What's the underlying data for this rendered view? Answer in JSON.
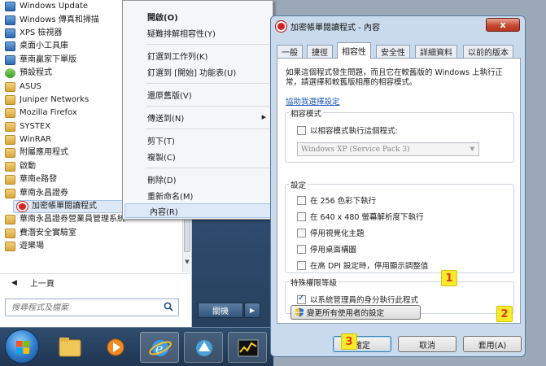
{
  "start_menu": {
    "programs": [
      {
        "label": "Windows Update",
        "icon": "app"
      },
      {
        "label": "Windows 傳真和掃描",
        "icon": "app"
      },
      {
        "label": "XPS 檢視器",
        "icon": "app"
      },
      {
        "label": "桌面小工具庫",
        "icon": "app"
      },
      {
        "label": "華南贏家下單版",
        "icon": "app"
      },
      {
        "label": "預設程式",
        "icon": "green"
      },
      {
        "label": "ASUS",
        "icon": "folder"
      },
      {
        "label": "Juniper Networks",
        "icon": "folder"
      },
      {
        "label": "Mozilla Firefox",
        "icon": "folder"
      },
      {
        "label": "SYSTEX",
        "icon": "folder"
      },
      {
        "label": "WinRAR",
        "icon": "folder"
      },
      {
        "label": "附屬應用程式",
        "icon": "folder"
      },
      {
        "label": "啟動",
        "icon": "folder"
      },
      {
        "label": "華南e路發",
        "icon": "folder"
      },
      {
        "label": "華南永昌證券",
        "icon": "folder"
      },
      {
        "label": "加密帳單閱讀程式",
        "icon": "red",
        "sub": true,
        "highlighted": true
      },
      {
        "label": "華南永昌證券營業員管理系統",
        "icon": "folder"
      },
      {
        "label": "費潛安全實驗室",
        "icon": "folder"
      },
      {
        "label": "遊樂場",
        "icon": "folder"
      }
    ],
    "back_label": "上一頁",
    "search_placeholder": "搜尋程式及檔案",
    "shutdown_label": "關機"
  },
  "context_menu": {
    "items": [
      {
        "label": "開啟(O)",
        "bold": true
      },
      {
        "label": "疑難排解相容性(Y)"
      },
      {
        "label": "釘選到工作列(K)"
      },
      {
        "label": "釘選到 [開始] 功能表(U)"
      },
      {
        "label": "還原舊版(V)"
      },
      {
        "label": "傳送到(N)",
        "submenu": true
      },
      {
        "label": "剪下(T)"
      },
      {
        "label": "複製(C)"
      },
      {
        "label": "刪除(D)"
      },
      {
        "label": "重新命名(M)"
      },
      {
        "label": "內容(R)",
        "selected": true
      }
    ]
  },
  "dialog": {
    "title": "加密帳單閱讀程式 - 內容",
    "close_label": "x",
    "tabs": [
      {
        "label": "一般"
      },
      {
        "label": "捷徑"
      },
      {
        "label": "相容性",
        "active": true
      },
      {
        "label": "安全性"
      },
      {
        "label": "詳細資料"
      },
      {
        "label": "以前的版本"
      }
    ],
    "description": "如果這個程式發生問題，而且它在較舊版的 Windows 上執行正常，請選擇和較舊版相應的相容模式。",
    "help_link": "協助我選擇設定",
    "compat_mode": {
      "group_label": "相容模式",
      "checkbox_label": "以相容模式執行這個程式:",
      "checked": false,
      "combo_value": "Windows XP (Service Pack 3)"
    },
    "settings": {
      "group_label": "設定",
      "options": [
        {
          "label": "在 256 色彩下執行",
          "checked": false
        },
        {
          "label": "在 640 x 480 螢幕解析度下執行",
          "checked": false
        },
        {
          "label": "停用視覺化主題",
          "checked": false
        },
        {
          "label": "停用桌面構圖",
          "checked": false
        },
        {
          "label": "在高 DPI 設定時，停用顯示調整值",
          "checked": false
        }
      ]
    },
    "privilege": {
      "group_label": "特殊權限等級",
      "checkbox_label": "以系統管理員的身分執行此程式",
      "checked": true
    },
    "all_users_button": "變更所有使用者的設定",
    "ok_label": "確定",
    "cancel_label": "取消",
    "apply_label": "套用(A)"
  },
  "callouts": [
    "1",
    "2",
    "3"
  ],
  "colors": {
    "accent_blue": "#1a57b8",
    "callout_fill": "#f6ea2a",
    "callout_text": "#e03a12",
    "close_red": "#c54b34"
  }
}
